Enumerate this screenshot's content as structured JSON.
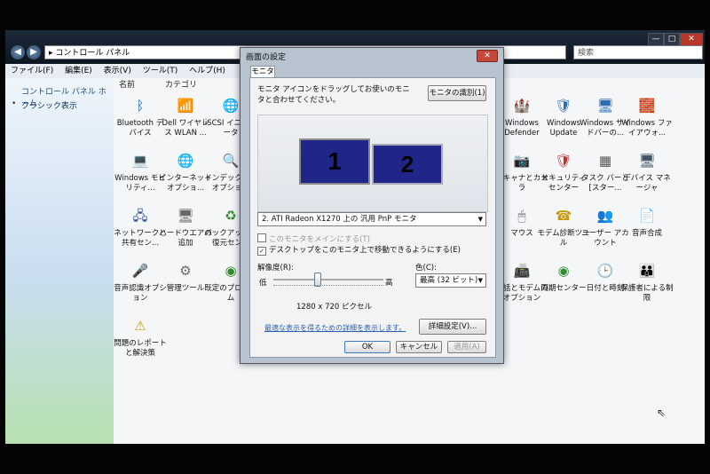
{
  "window": {
    "address": "▸ コントロール パネル",
    "search_placeholder": "検索",
    "controls": {
      "min": "—",
      "max": "□",
      "close": "✕"
    },
    "menu": [
      "ファイル(F)",
      "編集(E)",
      "表示(V)",
      "ツール(T)",
      "ヘルプ(H)"
    ]
  },
  "sidebar": {
    "home": "コントロール パネル ホーム",
    "classic": "クラシック表示",
    "bullet": "•"
  },
  "columns": {
    "name": "名前",
    "category": "カテゴリ"
  },
  "left_icons": [
    {
      "label": "Bluetooth デバイス",
      "glyph": "ᛒ",
      "icon": "bluetooth-icon",
      "color": "#1b5fb8"
    },
    {
      "label": "Dell ワイヤレス WLAN ...",
      "glyph": "📶",
      "icon": "wireless-icon",
      "color": "#444444"
    },
    {
      "label": "iSCSI イニシエータ",
      "glyph": "🌐",
      "icon": "iscsi-icon",
      "color": "#2f7d3a"
    },
    {
      "label": "Windows モビリティ...",
      "glyph": "💻",
      "icon": "mobility-icon",
      "color": "#3a6ea5"
    },
    {
      "label": "インターネット オプショ...",
      "glyph": "🌐",
      "icon": "internet-options-icon",
      "color": "#2b6bb0"
    },
    {
      "label": "インデックスのオプション",
      "glyph": "🔍",
      "icon": "indexing-icon",
      "color": "#7a7a7a"
    },
    {
      "label": "ネットワークと共有セン...",
      "glyph": "🖧",
      "icon": "network-icon",
      "color": "#2a4f8f"
    },
    {
      "label": "ハードウエアの追加",
      "glyph": "🖥",
      "icon": "add-hardware-icon",
      "color": "#666666"
    },
    {
      "label": "バックアップと復元セン...",
      "glyph": "♻",
      "icon": "backup-icon",
      "color": "#3a8a3a"
    },
    {
      "label": "音声認識オプション",
      "glyph": "🎤",
      "icon": "speech-icon",
      "color": "#777777"
    },
    {
      "label": "管理ツール",
      "glyph": "⚙",
      "icon": "admin-tools-icon",
      "color": "#6a6a6a"
    },
    {
      "label": "既定のプログラム",
      "glyph": "◉",
      "icon": "default-programs-icon",
      "color": "#2e8b2e"
    },
    {
      "label": "問題のレポートと解決策",
      "glyph": "⚠",
      "icon": "problem-reports-icon",
      "color": "#c9a10a"
    }
  ],
  "right_icons": [
    {
      "label": "Windows Defender",
      "glyph": "🏰",
      "icon": "defender-icon",
      "color": "#556677"
    },
    {
      "label": "Windows Update",
      "glyph": "🛡",
      "icon": "windows-update-icon",
      "color": "#2c6fb5"
    },
    {
      "label": "Windows サイドバーの...",
      "glyph": "🖥",
      "icon": "sidebar-icon",
      "color": "#2c6fb5"
    },
    {
      "label": "Windows ファイアウォ...",
      "glyph": "🧱",
      "icon": "firewall-icon",
      "color": "#8b3a2a"
    },
    {
      "label": "スキャナとカメラ",
      "glyph": "📷",
      "icon": "scanner-camera-icon",
      "color": "#555555"
    },
    {
      "label": "セキュリティ センター",
      "glyph": "🛡",
      "icon": "security-center-icon",
      "color": "#c03030"
    },
    {
      "label": "タスク バーと [スター...",
      "glyph": "▦",
      "icon": "taskbar-icon",
      "color": "#555555"
    },
    {
      "label": "デバイス マネージャ",
      "glyph": "🖥",
      "icon": "device-manager-icon",
      "color": "#445566"
    },
    {
      "label": "マウス",
      "glyph": "🖱",
      "icon": "mouse-icon",
      "color": "#666666"
    },
    {
      "label": "モデム診断ツール",
      "glyph": "☎",
      "icon": "modem-diagnostic-icon",
      "color": "#c89a10"
    },
    {
      "label": "ユーザー アカウント",
      "glyph": "👥",
      "icon": "user-accounts-icon",
      "color": "#3a6ea5"
    },
    {
      "label": "音声合成",
      "glyph": "📄",
      "icon": "speech-synthesis-icon",
      "color": "#777777"
    },
    {
      "label": "電話とモデムのオプション",
      "glyph": "📠",
      "icon": "phone-modem-icon",
      "color": "#666666"
    },
    {
      "label": "同期センター",
      "glyph": "◉",
      "icon": "sync-center-icon",
      "color": "#2e8b2e"
    },
    {
      "label": "日付と時刻",
      "glyph": "🕒",
      "icon": "date-time-icon",
      "color": "#3a6ea5"
    },
    {
      "label": "保護者による制限",
      "glyph": "👪",
      "icon": "parental-controls-icon",
      "color": "#3a6ea5"
    }
  ],
  "dialog": {
    "title": "画面の設定",
    "close": "✕",
    "tab": "モニタ",
    "instruction": "モニタ アイコンをドラッグしてお使いのモニタと合わせてください。",
    "identify_button": "モニタの識別(1)",
    "monitor1": "1",
    "monitor2": "2",
    "display_select": "2. ATI Radeon X1270  上の 汎用 PnP モニタ",
    "primary_checkbox": "このモニタをメインにする(T)",
    "extend_checkbox": "デスクトップをこのモニタ上で移動できるようにする(E)",
    "check_mark": "✓",
    "resolution_label": "解像度(R):",
    "low": "低",
    "high": "高",
    "resolution_value": "1280 x 720 ピクセル",
    "color_label": "色(C):",
    "color_select": "最高 (32 ビット)",
    "advanced_button": "詳細設定(V)...",
    "help_link": "最適な表示を得るための詳細を表示します。",
    "ok": "OK",
    "cancel": "キャンセル",
    "apply": "適用(A)"
  }
}
